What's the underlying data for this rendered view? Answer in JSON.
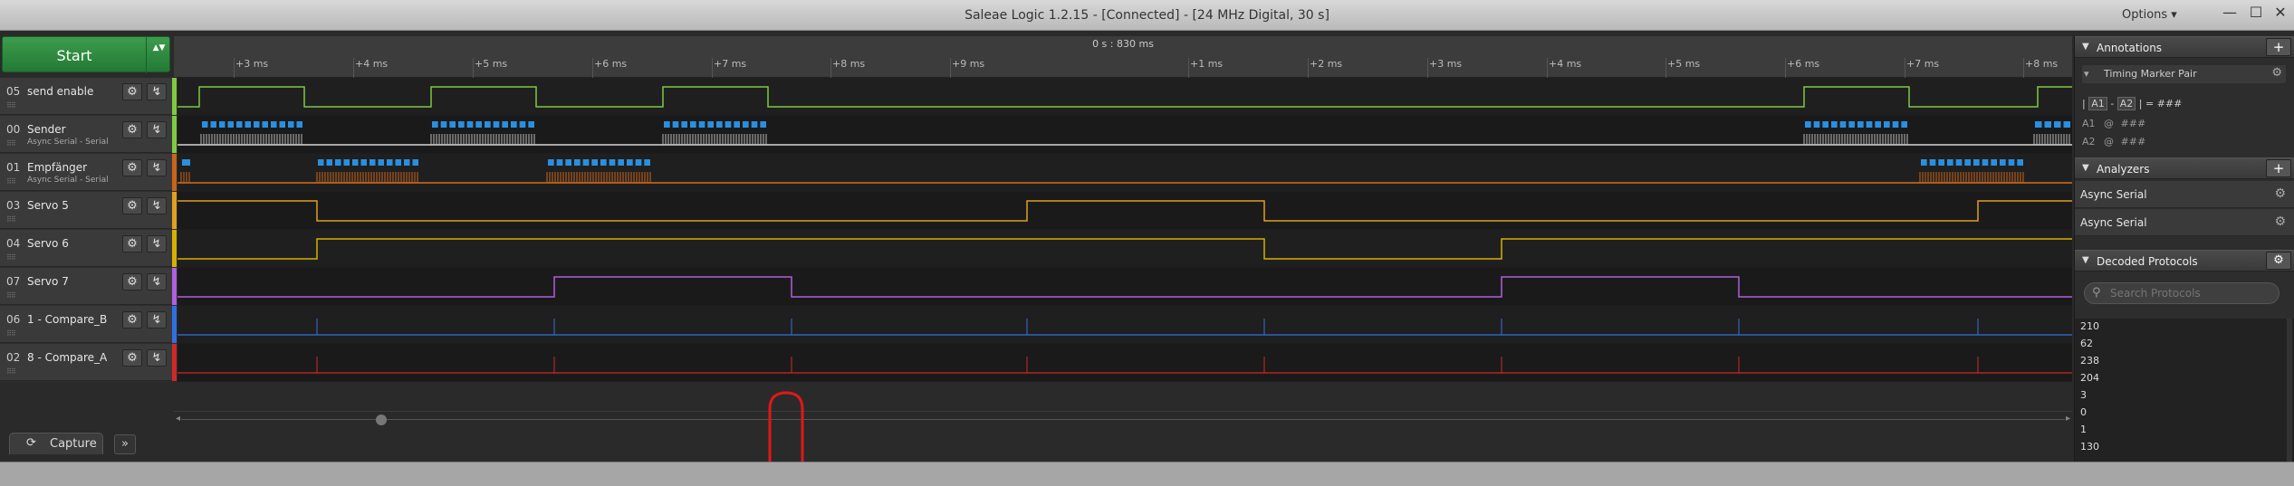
{
  "window": {
    "title": "Saleae Logic 1.2.15 - [Connected] - [24 MHz Digital, 30 s]",
    "options_label": "Options ▾",
    "minimize": "—",
    "maximize": "☐",
    "close": "✕"
  },
  "start_button": {
    "label": "Start",
    "arrows": "▲▼"
  },
  "timeline": {
    "cursor_label": "0 s : 830 ms",
    "ticks": [
      "+3 ms",
      "+4 ms",
      "+5 ms",
      "+6 ms",
      "+7 ms",
      "+8 ms",
      "+9 ms",
      "+1 ms",
      "+2 ms",
      "+3 ms",
      "+4 ms",
      "+5 ms",
      "+6 ms",
      "+7 ms",
      "+8 ms"
    ]
  },
  "channels": [
    {
      "num": "05",
      "name": "send enable",
      "sub": "",
      "color": "#7ec940"
    },
    {
      "num": "00",
      "name": "Sender",
      "sub": "Async Serial - Serial",
      "color": "#7ec940"
    },
    {
      "num": "01",
      "name": "Empfänger",
      "sub": "Async Serial - Serial",
      "color": "#c8651b"
    },
    {
      "num": "03",
      "name": "Servo 5",
      "sub": "",
      "color": "#e0a020"
    },
    {
      "num": "04",
      "name": "Servo 6",
      "sub": "",
      "color": "#d6b000"
    },
    {
      "num": "07",
      "name": "Servo 7",
      "sub": "",
      "color": "#b060e0"
    },
    {
      "num": "06",
      "name": "1 - Compare_B",
      "sub": "",
      "color": "#3070e0"
    },
    {
      "num": "02",
      "name": "8 - Compare_A",
      "sub": "",
      "color": "#d02828"
    }
  ],
  "channel_icons": {
    "settings": "⚙",
    "trigger": "↯",
    "grip": "⠿⠿"
  },
  "bottom": {
    "capture_tab": "Capture",
    "capture_icon": "⟳",
    "more_tab": "»"
  },
  "annotations": {
    "title": "Annotations",
    "add": "+",
    "timing_marker": "Timing Marker Pair",
    "formula_a1": "A1",
    "formula_a2": "A2",
    "formula_sep": "-",
    "formula_eq": "= ###",
    "a1_label": "A1",
    "a1_at": "@",
    "a1_val": "###",
    "a2_label": "A2",
    "a2_at": "@",
    "a2_val": "###"
  },
  "analyzers": {
    "title": "Analyzers",
    "add": "+",
    "items": [
      "Async Serial",
      "Async Serial"
    ]
  },
  "decoded": {
    "title": "Decoded Protocols",
    "search_placeholder": "Search Protocols",
    "values": [
      "210",
      "62",
      "238",
      "204",
      "3",
      "0",
      "1",
      "130"
    ]
  },
  "icons": {
    "gear": "gear-icon",
    "search": "search-icon",
    "collapse": "triangle-down-icon",
    "pin": "pin-icon"
  }
}
